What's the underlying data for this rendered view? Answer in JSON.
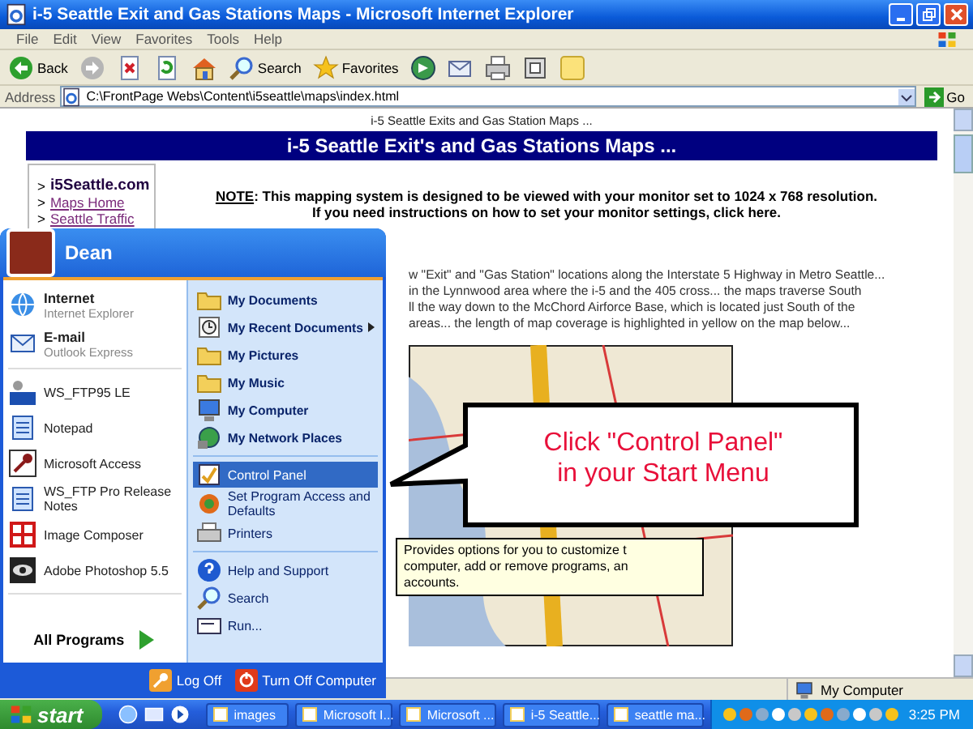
{
  "window": {
    "title": "i-5 Seattle Exit and Gas Stations Maps - Microsoft Internet Explorer"
  },
  "menu_bar": [
    "File",
    "Edit",
    "View",
    "Favorites",
    "Tools",
    "Help"
  ],
  "toolbar": [
    {
      "kind": "back",
      "label": "Back"
    },
    {
      "kind": "forward"
    },
    {
      "kind": "stop"
    },
    {
      "kind": "refresh"
    },
    {
      "kind": "home"
    },
    {
      "kind": "search",
      "label": "Search"
    },
    {
      "kind": "favorites",
      "label": "Favorites"
    },
    {
      "kind": "media"
    },
    {
      "kind": "mail"
    },
    {
      "kind": "print"
    },
    {
      "kind": "edit"
    },
    {
      "kind": "discuss"
    }
  ],
  "address_bar": {
    "label": "Address",
    "value": "C:\\FrontPage Webs\\Content\\i5seattle\\maps\\index.html",
    "go": "Go"
  },
  "page": {
    "caption": "i-5 Seattle Exits and Gas Station Maps ...",
    "banner": "i-5 Seattle Exit's and Gas Stations Maps ...",
    "sidebar_links": [
      {
        "marker": ">",
        "label": "i5Seattle.com",
        "current": true
      },
      {
        "marker": ">",
        "label": "Maps Home",
        "current": false
      },
      {
        "marker": ">",
        "label": "Seattle Traffic",
        "current": false
      }
    ],
    "note": {
      "label": "NOTE",
      "text": ": This mapping system is designed to be viewed with your monitor set to 1024 x 768 resolution."
    },
    "note_line_2": "If you need instructions on how to set your monitor settings, click here.",
    "intro_lines": [
      "w \"Exit\" and \"Gas Station\" locations along the Interstate 5 Highway in Metro Seattle...",
      "in the Lynnwood area where the i-5 and the 405 cross... the maps traverse South",
      "ll the way down to the McChord Airforce Base, which is located just South of the",
      "areas... the length of map coverage is highlighted in yellow on the map below..."
    ]
  },
  "status_bar": {
    "zone": "My Computer"
  },
  "start_menu": {
    "user": "Dean",
    "pinned": [
      {
        "title": "Internet",
        "subtitle": "Internet Explorer"
      },
      {
        "title": "E-mail",
        "subtitle": "Outlook Express"
      }
    ],
    "recent": [
      "WS_FTP95 LE",
      "Notepad",
      "Microsoft Access",
      "WS_FTP Pro Release Notes",
      "Image Composer",
      "Adobe Photoshop 5.5"
    ],
    "all_programs": "All Programs",
    "places": [
      [
        {
          "label": "My Documents",
          "selected": false,
          "submenu": false
        },
        {
          "label": "My Recent Documents",
          "selected": false,
          "submenu": true
        },
        {
          "label": "My Pictures",
          "selected": false,
          "submenu": false
        },
        {
          "label": "My Music",
          "selected": false,
          "submenu": false
        },
        {
          "label": "My Computer",
          "selected": false,
          "submenu": false
        },
        {
          "label": "My Network Places",
          "selected": false,
          "submenu": false
        }
      ],
      [
        {
          "label": "Control Panel",
          "selected": true,
          "submenu": false
        },
        {
          "label": "Set Program Access and Defaults",
          "selected": false,
          "submenu": false
        },
        {
          "label": "Printers",
          "selected": false,
          "submenu": false
        }
      ],
      [
        {
          "label": "Help and Support",
          "selected": false,
          "submenu": false
        },
        {
          "label": "Search",
          "selected": false,
          "submenu": false
        },
        {
          "label": "Run...",
          "selected": false,
          "submenu": false
        }
      ]
    ],
    "log_off": "Log Off",
    "turn_off": "Turn Off Computer"
  },
  "tooltip": [
    "Provides options for you to customize t",
    "computer, add or remove programs, an",
    "accounts."
  ],
  "callout": [
    "Click \"Control Panel\"",
    "in your Start Menu"
  ],
  "taskbar": {
    "start": "start",
    "tasks": [
      "images",
      "Microsoft I...",
      "Microsoft ...",
      "i-5 Seattle...",
      "seattle ma..."
    ],
    "clock": "3:25 PM"
  }
}
